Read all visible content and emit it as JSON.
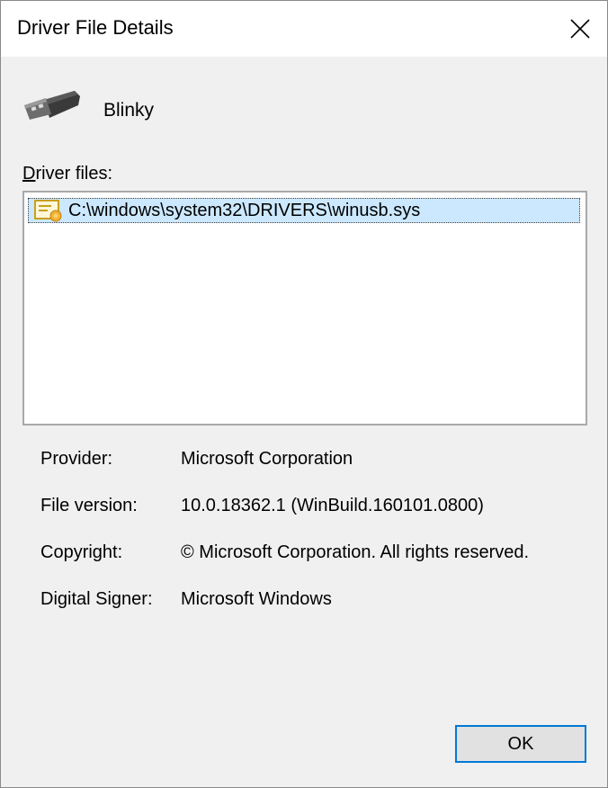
{
  "window": {
    "title": "Driver File Details"
  },
  "device": {
    "name": "Blinky",
    "icon": "usb-connector-icon"
  },
  "driver_files": {
    "label_prefix": "D",
    "label_rest": "river files:",
    "items": [
      {
        "path": "C:\\windows\\system32\\DRIVERS\\winusb.sys",
        "icon": "signed-driver-file-icon",
        "selected": true
      }
    ]
  },
  "details": {
    "provider_label": "Provider:",
    "provider_value": "Microsoft Corporation",
    "version_label": "File version:",
    "version_value": "10.0.18362.1 (WinBuild.160101.0800)",
    "copyright_label": "Copyright:",
    "copyright_value": "© Microsoft Corporation. All rights reserved.",
    "signer_label": "Digital Signer:",
    "signer_value": "Microsoft Windows"
  },
  "buttons": {
    "ok_label": "OK"
  },
  "colors": {
    "selection": "#cce8ff",
    "focus_border": "#0078d7",
    "dialog_bg": "#f0f0f0"
  }
}
